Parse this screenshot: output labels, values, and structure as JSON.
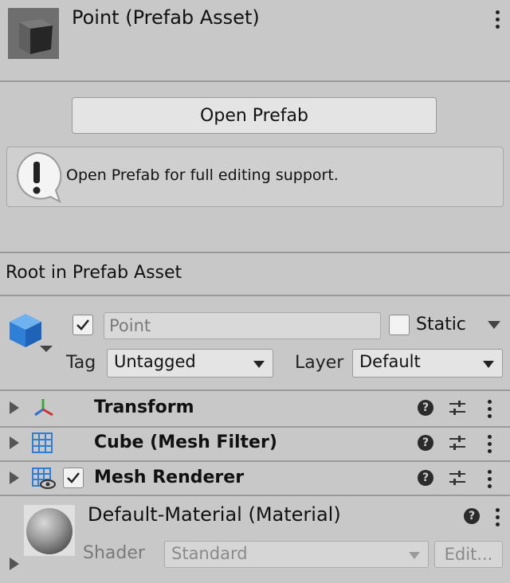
{
  "header": {
    "title": "Point (Prefab Asset)",
    "thumbnail_icon": "cube-prefab-icon"
  },
  "prefab": {
    "open_button_label": "Open Prefab",
    "info_message": "Open Prefab for full editing support.",
    "info_icon": "warning-exclamation-icon"
  },
  "section": {
    "root_label": "Root in Prefab Asset"
  },
  "gameobject": {
    "icon": "gameobject-cube-icon",
    "active": true,
    "name": "Point",
    "static_label": "Static",
    "static_checked": false,
    "tag_label": "Tag",
    "tag_value": "Untagged",
    "layer_label": "Layer",
    "layer_value": "Default"
  },
  "components": [
    {
      "title": "Transform",
      "icon": "transform-axes-icon",
      "has_checkbox": false
    },
    {
      "title": "Cube (Mesh Filter)",
      "icon": "mesh-filter-grid-icon",
      "has_checkbox": false
    },
    {
      "title": "Mesh Renderer",
      "icon": "mesh-renderer-icon",
      "has_checkbox": true,
      "enabled": true
    }
  ],
  "material": {
    "title": "Default-Material (Material)",
    "shader_label": "Shader",
    "shader_value": "Standard",
    "edit_label": "Edit..."
  },
  "colors": {
    "background": "#c8c8c8",
    "accent_blue": "#2f7fd6",
    "button": "#e4e4e4"
  }
}
